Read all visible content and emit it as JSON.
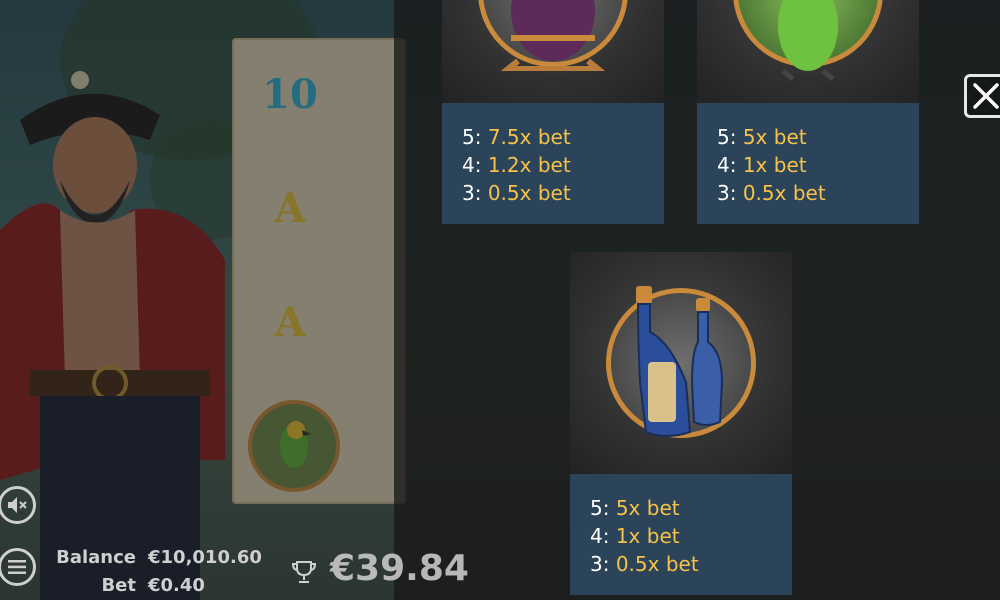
{
  "game": {
    "balance_label": "Balance",
    "balance_value": "€10,010.60",
    "bet_label": "Bet",
    "bet_value": "€0.40",
    "win_amount": "€39.84"
  },
  "reels": {
    "symbols": [
      "10",
      "A",
      "A"
    ]
  },
  "paytable": {
    "cards": [
      {
        "symbol": "barrel-icon",
        "pays": [
          {
            "count": "5:",
            "value": "7.5x bet"
          },
          {
            "count": "4:",
            "value": "1.2x bet"
          },
          {
            "count": "3:",
            "value": "0.5x bet"
          }
        ]
      },
      {
        "symbol": "parrot-icon",
        "pays": [
          {
            "count": "5:",
            "value": "5x bet"
          },
          {
            "count": "4:",
            "value": "1x bet"
          },
          {
            "count": "3:",
            "value": "0.5x bet"
          }
        ]
      },
      {
        "symbol": "bottle-icon",
        "pays": [
          {
            "count": "5:",
            "value": "5x bet"
          },
          {
            "count": "4:",
            "value": "1x bet"
          },
          {
            "count": "3:",
            "value": "0.5x bet"
          }
        ]
      }
    ]
  },
  "colors": {
    "pay_value": "#f6c24a",
    "info_bg": "#2b4459",
    "medal_ring": "#c98a3c"
  }
}
